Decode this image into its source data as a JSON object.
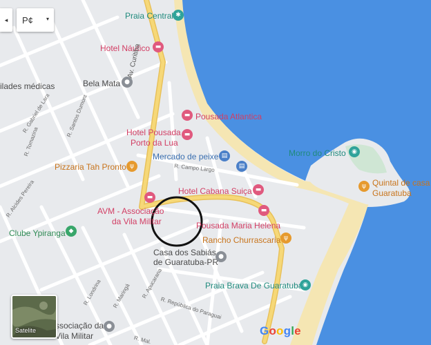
{
  "controls": {
    "collapse_arrow": "◂",
    "map_type_value": "P¢",
    "dropdown_chevron": "▾",
    "satellite_label": "Satelite"
  },
  "attribution": {
    "letters": [
      {
        "ch": "G",
        "color": "#4285f4"
      },
      {
        "ch": "o",
        "color": "#ea4335"
      },
      {
        "ch": "o",
        "color": "#fbbc05"
      },
      {
        "ch": "g",
        "color": "#4285f4"
      },
      {
        "ch": "l",
        "color": "#34a853"
      },
      {
        "ch": "e",
        "color": "#ea4335"
      }
    ]
  },
  "pois": {
    "praia_central": "Praia Central",
    "hotel_nautico": "Hotel Náutico",
    "lades_medicas": "ilades médicas",
    "bela_mata": "Bela Mata",
    "pousada_atlantica": "Pousada Atlantica",
    "hotel_pousada_line1": "Hotel Pousada",
    "hotel_pousada_line2": "Porto da Lua",
    "mercado_de_peixe": "Mercado de peixe",
    "morro_do_cristo": "Morro do Cristo",
    "pizzaria": "Pizzaria Tah Pronto",
    "quintal_line1": "Quintal de casa",
    "quintal_line2": "Guaratuba",
    "hotel_cabana": "Hotel Cabana Suiça",
    "avm_line1": "AVM - Associação",
    "avm_line2": "da Vila Militar",
    "pousada_maria": "Pousada Maria Helena",
    "clube": "Clube Ypiranga",
    "rancho": "Rancho Churrascaria",
    "casa_sabias_line1": "Casa dos Sabiás",
    "casa_sabias_line2": "de Guaratuba-PR",
    "praia_brava": "Praia Brava De Guaratuba",
    "associacao_line1": "ssociação da",
    "associacao_line2": "Vila Militar"
  },
  "streets": {
    "av_curitiba": "Av. Curitiba",
    "r_campo_largo": "R. Campo Largo",
    "r_gabriel": "R. Gabriel de Lara",
    "r_santos_dumont": "R. Santos Dumont",
    "r_tomazina": "R. Tomazina",
    "r_alcides": "R. Alcides Pereira",
    "r_londrina": "R. Londrina",
    "r_maringa": "R. Maringá",
    "r_apucarana": "R. Apucarana",
    "r_paraguai": "R. República do Paraguai",
    "r_mal": "R. Mal."
  },
  "colors": {
    "land": "#e8eaed",
    "water": "#4a90e2",
    "beach": "#f5e6b3",
    "arterial": "#f2c94c",
    "hotel_red": "#d23e64",
    "circle": "#111111"
  }
}
